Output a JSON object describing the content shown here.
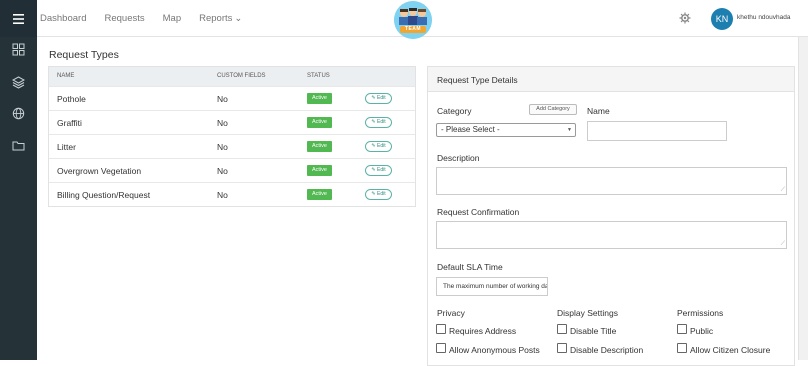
{
  "nav": {
    "items": [
      {
        "label": "Dashboard"
      },
      {
        "label": "Requests"
      },
      {
        "label": "Map"
      },
      {
        "label": "Reports"
      }
    ],
    "reports_caret": "⌄"
  },
  "logo_text": "TEAM",
  "user": {
    "initials": "KN",
    "name": "khethu ndouvhada"
  },
  "page": {
    "section_title": "Request Types"
  },
  "table": {
    "headers": {
      "name": "NAME",
      "custom_fields": "CUSTOM FIELDS",
      "status": "STATUS"
    },
    "rows": [
      {
        "name": "Pothole",
        "custom": "No",
        "status": "Active",
        "edit": "Edit"
      },
      {
        "name": "Graffiti",
        "custom": "No",
        "status": "Active",
        "edit": "Edit"
      },
      {
        "name": "Litter",
        "custom": "No",
        "status": "Active",
        "edit": "Edit"
      },
      {
        "name": "Overgrown Vegetation",
        "custom": "No",
        "status": "Active",
        "edit": "Edit"
      },
      {
        "name": "Billing Question/Request",
        "custom": "No",
        "status": "Active",
        "edit": "Edit"
      }
    ],
    "status_color": "#52b852"
  },
  "details": {
    "title": "Request Type Details",
    "category_label": "Category",
    "add_category": "Add Category",
    "category_value": "- Please Select -",
    "name_label": "Name",
    "description_label": "Description",
    "confirmation_label": "Request Confirmation",
    "sla_label": "Default SLA Time",
    "sla_value": "The maximum number of working day",
    "privacy_label": "Privacy",
    "display_label": "Display Settings",
    "permissions_label": "Permissions",
    "privacy_options": [
      "Requires Address",
      "Allow Anonymous Posts"
    ],
    "display_options": [
      "Disable Title",
      "Disable Description"
    ],
    "permission_options": [
      "Public",
      "Allow Citizen Closure"
    ]
  }
}
